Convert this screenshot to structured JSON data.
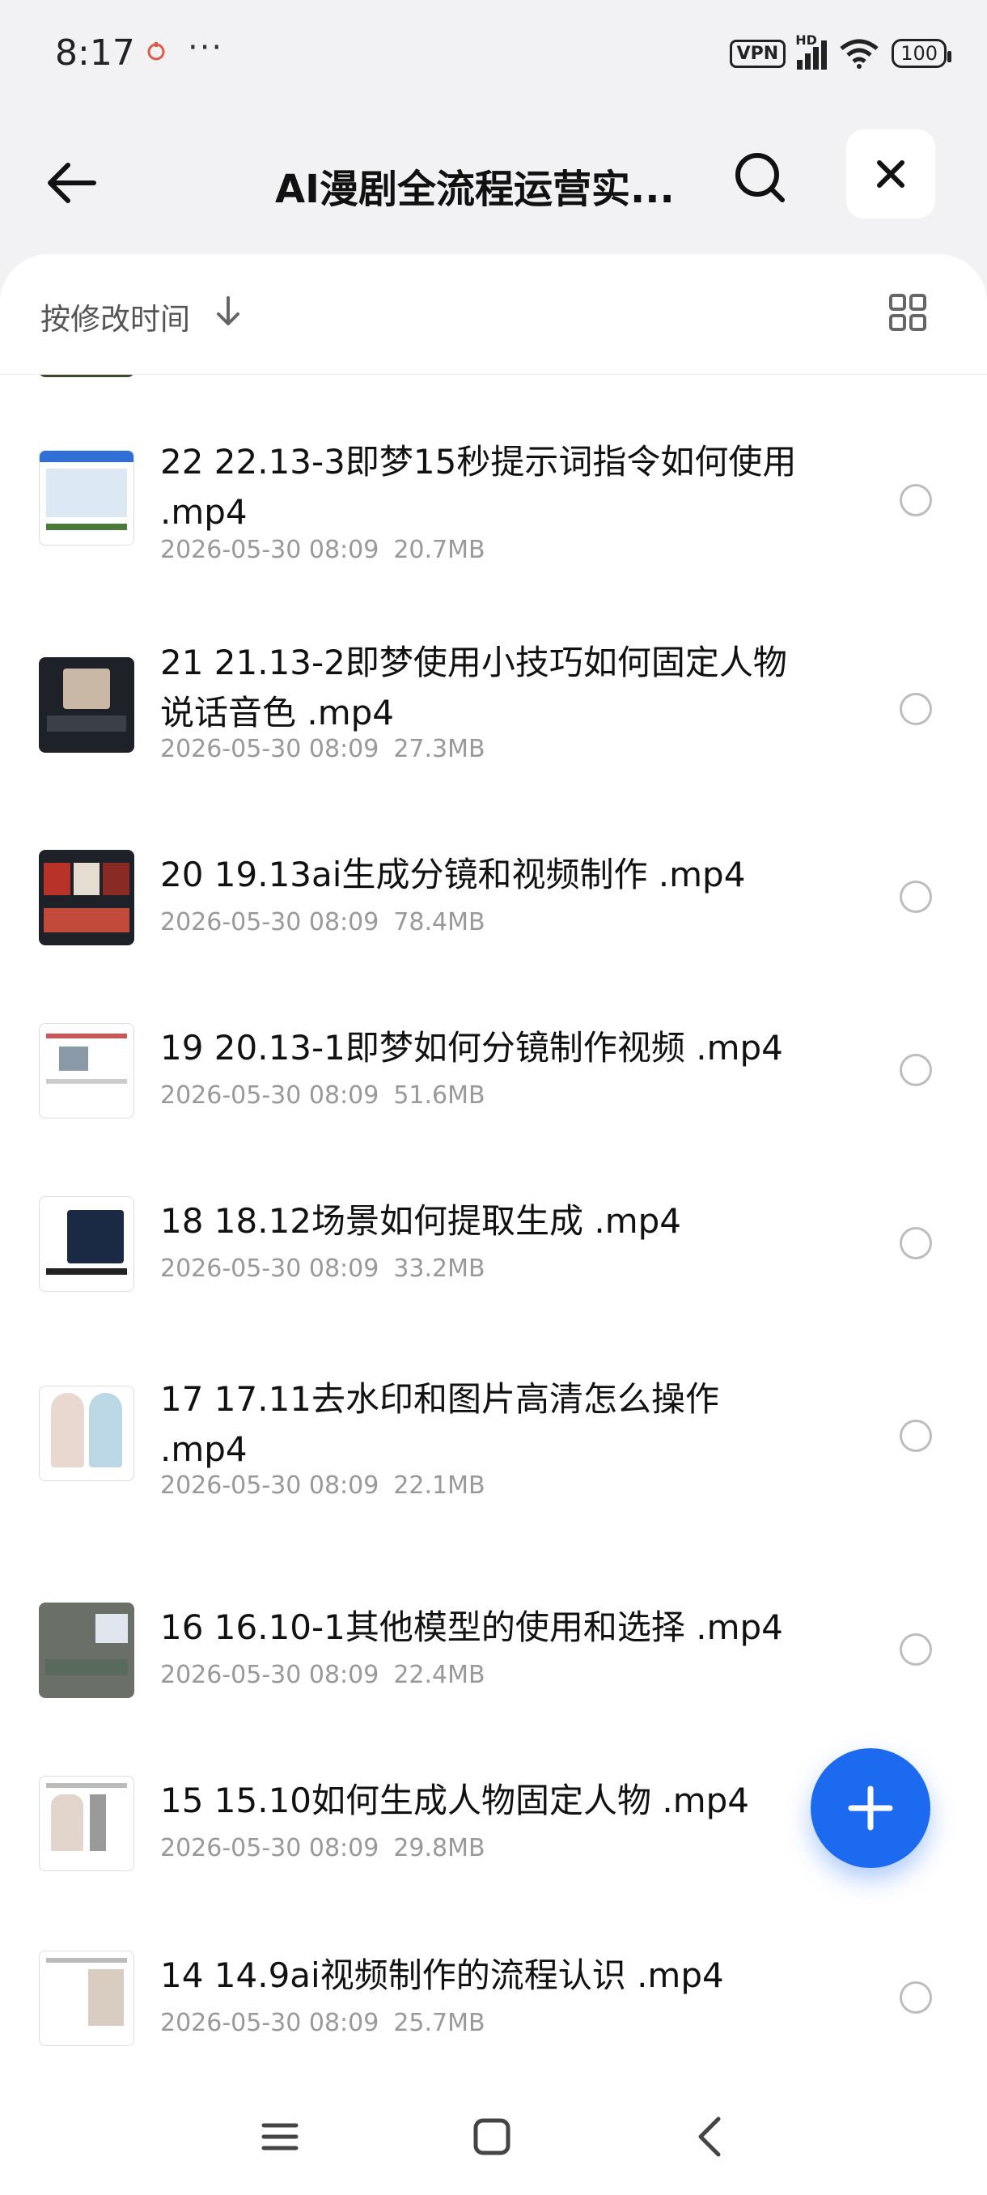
{
  "status_bar": {
    "time": "8:17",
    "more": "···",
    "vpn": "VPN",
    "network": "HD",
    "battery": "100"
  },
  "header": {
    "title": "AI漫剧全流程运营实..."
  },
  "sort": {
    "label": "按修改时间"
  },
  "files": [
    {
      "name": "22 22.13-3即梦15秒提示词指令如何使用 .mp4",
      "date": "2026-05-30 08:09",
      "size": "20.7MB",
      "thumb": "doc"
    },
    {
      "name": "21 21.13-2即梦使用小技巧如何固定人物说话音色 .mp4",
      "date": "2026-05-30 08:09",
      "size": "27.3MB",
      "thumb": "dark"
    },
    {
      "name": "20 19.13ai生成分镜和视频制作 .mp4",
      "date": "2026-05-30 08:09",
      "size": "78.4MB",
      "thumb": "dark"
    },
    {
      "name": "19 20.13-1即梦如何分镜制作视频 .mp4",
      "date": "2026-05-30 08:09",
      "size": "51.6MB",
      "thumb": "doc"
    },
    {
      "name": "18 18.12场景如何提取生成 .mp4",
      "date": "2026-05-30 08:09",
      "size": "33.2MB",
      "thumb": "doc"
    },
    {
      "name": "17 17.11去水印和图片高清怎么操作 .mp4",
      "date": "2026-05-30 08:09",
      "size": "22.1MB",
      "thumb": "doc"
    },
    {
      "name": "16 16.10-1其他模型的使用和选择 .mp4",
      "date": "2026-05-30 08:09",
      "size": "22.4MB",
      "thumb": "grey"
    },
    {
      "name": "15 15.10如何生成人物固定人物 .mp4",
      "date": "2026-05-30 08:09",
      "size": "29.8MB",
      "thumb": "doc"
    },
    {
      "name": "14 14.9ai视频制作的流程认识 .mp4",
      "date": "2026-05-30 08:09",
      "size": "25.7MB",
      "thumb": "doc"
    }
  ],
  "colors": {
    "accent": "#1b6af0",
    "meta_text": "#999999",
    "background": "#f2f2f4"
  },
  "icons": {
    "back": "arrow-left-icon",
    "search": "search-icon",
    "close": "close-icon",
    "sort": "arrow-down-icon",
    "view": "grid-view-icon",
    "add": "plus-icon",
    "nav_menu": "menu-icon",
    "nav_home": "home-square-icon",
    "nav_back": "chevron-left-icon"
  }
}
